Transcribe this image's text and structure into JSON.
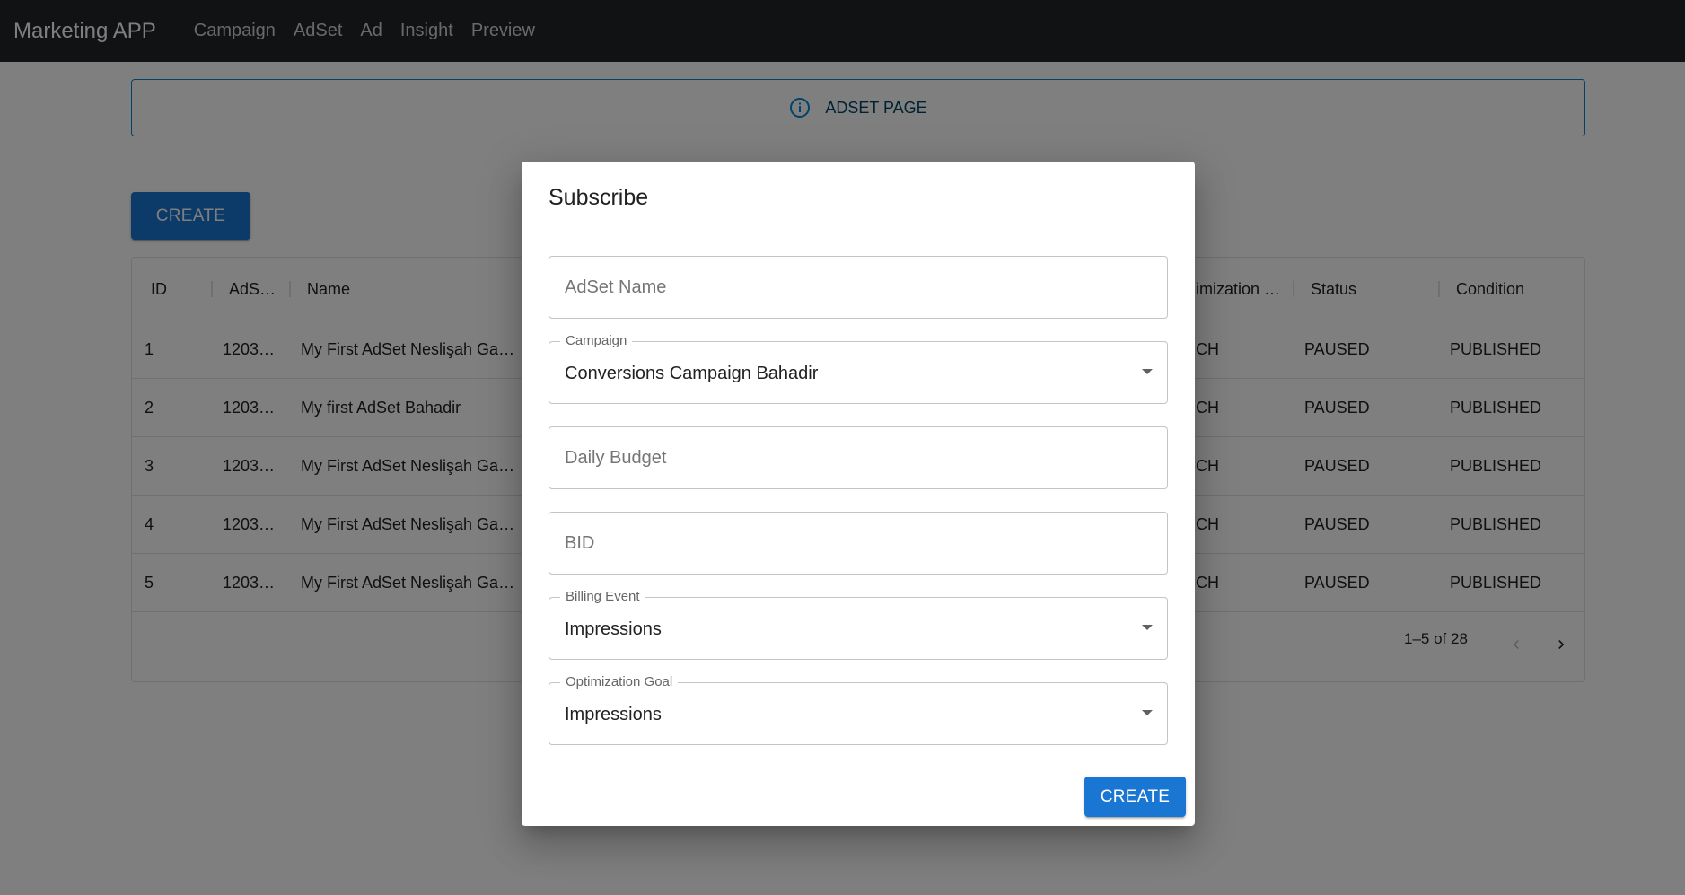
{
  "navbar": {
    "brand": "Marketing APP",
    "links": [
      "Campaign",
      "AdSet",
      "Ad",
      "Insight",
      "Preview"
    ]
  },
  "alert": {
    "text": "ADSET PAGE",
    "icon": "info-icon"
  },
  "page": {
    "create_label": "CREATE"
  },
  "table": {
    "columns": [
      "ID",
      "AdS…",
      "Name",
      "imization …",
      "Status",
      "Condition"
    ],
    "rows": [
      {
        "id": "1",
        "adset": "1203…",
        "name": "My First AdSet Neslişah Ga…",
        "goal": "CH",
        "status": "PAUSED",
        "condition": "PUBLISHED"
      },
      {
        "id": "2",
        "adset": "1203…",
        "name": "My first AdSet Bahadir",
        "goal": "CH",
        "status": "PAUSED",
        "condition": "PUBLISHED"
      },
      {
        "id": "3",
        "adset": "1203…",
        "name": "My First AdSet Neslişah Ga…",
        "goal": "CH",
        "status": "PAUSED",
        "condition": "PUBLISHED"
      },
      {
        "id": "4",
        "adset": "1203…",
        "name": "My First AdSet Neslişah Ga…",
        "goal": "CH",
        "status": "PAUSED",
        "condition": "PUBLISHED"
      },
      {
        "id": "5",
        "adset": "1203…",
        "name": "My First AdSet Neslişah Ga…",
        "goal": "CH",
        "status": "PAUSED",
        "condition": "PUBLISHED"
      }
    ],
    "pagination": "1–5 of 28"
  },
  "dialog": {
    "title": "Subscribe",
    "adset_name_placeholder": "AdSet Name",
    "campaign_label": "Campaign",
    "campaign_value": "Conversions Campaign Bahadir",
    "daily_budget_placeholder": "Daily Budget",
    "bid_placeholder": "BID",
    "billing_event_label": "Billing Event",
    "billing_event_value": "Impressions",
    "optimization_goal_label": "Optimization Goal",
    "optimization_goal_value": "Impressions",
    "create_label": "CREATE"
  },
  "colors": {
    "primary": "#1976d2",
    "navbar": "#212529",
    "info": "#0288d1"
  }
}
